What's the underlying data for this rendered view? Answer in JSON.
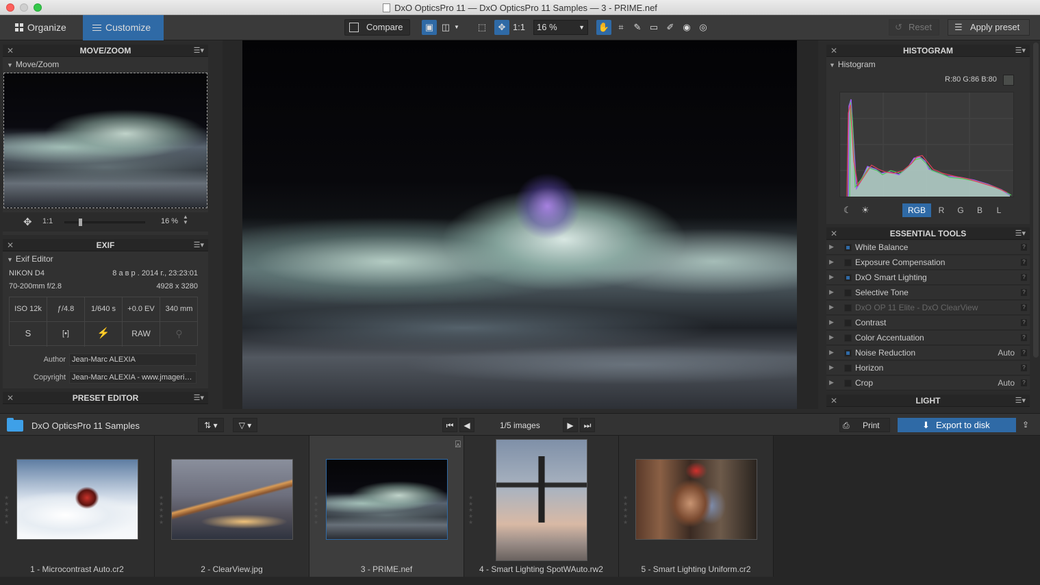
{
  "window": {
    "title": "DxO OpticsPro 11 — DxO OpticsPro 11 Samples — 3 - PRIME.nef"
  },
  "toolbar": {
    "tab_organize": "Organize",
    "tab_customize": "Customize",
    "compare": "Compare",
    "one_to_one": "1:1",
    "zoom": "16 %",
    "reset": "Reset",
    "apply_preset": "Apply preset"
  },
  "move_zoom": {
    "title": "MOVE/ZOOM",
    "subtitle": "Move/Zoom",
    "ratio": "1:1",
    "zoom": "16 %"
  },
  "exif": {
    "title": "EXIF",
    "subtitle": "Exif Editor",
    "camera": "NIKON D4",
    "datetime": "8 а в р . 2014 г., 23:23:01",
    "lens": "70-200mm f/2.8",
    "dimensions": "4928 x 3280",
    "iso": "ISO 12k",
    "aperture": "ƒ/4.8",
    "shutter": "1/640 s",
    "ev": "+0.0 EV",
    "focal": "340 mm",
    "mode": "S",
    "format": "RAW",
    "author_label": "Author",
    "author_value": "Jean-Marc ALEXIA",
    "copyright_label": "Copyright",
    "copyright_value": "Jean-Marc ALEXIA - www.jmageri…"
  },
  "preset_editor": {
    "title": "PRESET EDITOR"
  },
  "histogram": {
    "title": "HISTOGRAM",
    "subtitle": "Histogram",
    "readout": "R:80 G:86 B:80",
    "channels": [
      "RGB",
      "R",
      "G",
      "B",
      "L"
    ]
  },
  "essential_tools": {
    "title": "ESSENTIAL TOOLS",
    "items": [
      {
        "label": "White Balance",
        "on": true,
        "auto": ""
      },
      {
        "label": "Exposure Compensation",
        "on": false,
        "auto": ""
      },
      {
        "label": "DxO Smart Lighting",
        "on": true,
        "auto": ""
      },
      {
        "label": "Selective Tone",
        "on": false,
        "auto": ""
      },
      {
        "label": "DxO OP 11 Elite - DxO ClearView",
        "on": false,
        "auto": "",
        "disabled": true
      },
      {
        "label": "Contrast",
        "on": false,
        "auto": ""
      },
      {
        "label": "Color Accentuation",
        "on": false,
        "auto": ""
      },
      {
        "label": "Noise Reduction",
        "on": true,
        "auto": "Auto"
      },
      {
        "label": "Horizon",
        "on": false,
        "auto": ""
      },
      {
        "label": "Crop",
        "on": false,
        "auto": "Auto"
      }
    ]
  },
  "light": {
    "title": "LIGHT"
  },
  "filmbar": {
    "folder": "DxO OpticsPro 11 Samples",
    "count": "1/5 images",
    "print": "Print",
    "export": "Export to disk"
  },
  "filmstrip": [
    {
      "caption": "1 - Microcontrast Auto.cr2"
    },
    {
      "caption": "2 - ClearView.jpg"
    },
    {
      "caption": "3 - PRIME.nef"
    },
    {
      "caption": "4 - Smart Lighting SpotWAuto.rw2"
    },
    {
      "caption": "5 - Smart Lighting Uniform.cr2"
    }
  ],
  "colors": {
    "accent": "#2f6aa6",
    "folder": "#3ea0e8"
  }
}
